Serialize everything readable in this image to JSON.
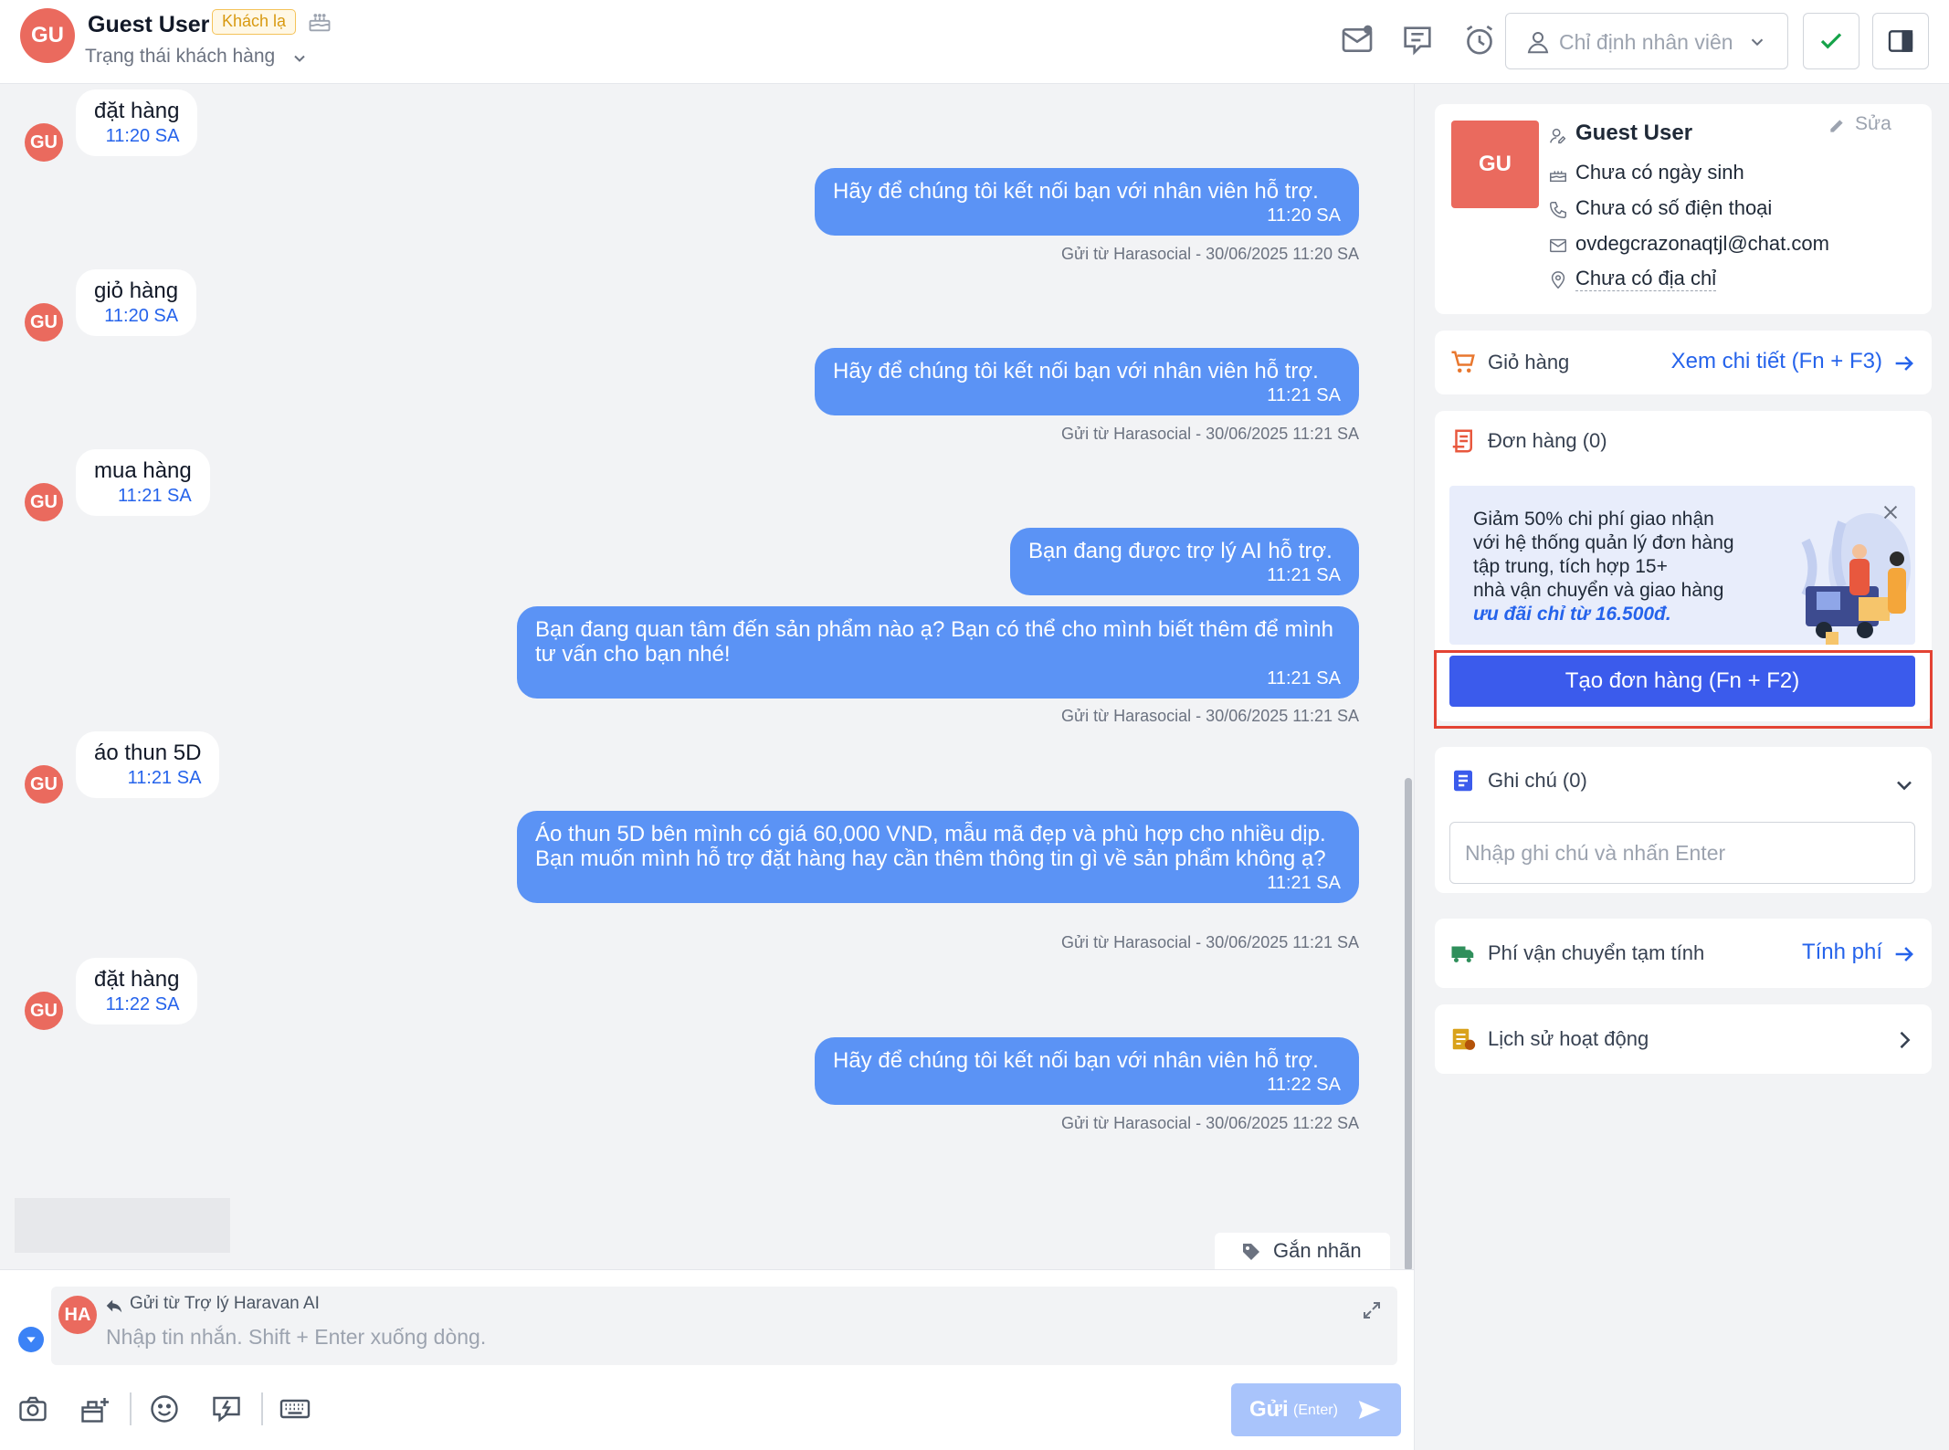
{
  "header": {
    "avatar": "GU",
    "name": "Guest User",
    "badge": "Khách lạ",
    "status": "Trạng thái khách hàng",
    "assign_placeholder": "Chỉ định nhân viên"
  },
  "messages": [
    {
      "dir": "in",
      "text": "đặt hàng",
      "time": "11:20 SA"
    },
    {
      "dir": "out",
      "text": "Hãy để chúng tôi kết nối bạn với nhân viên hỗ trợ.",
      "time": "11:20 SA",
      "meta": "Gửi từ Harasocial - 30/06/2025 11:20 SA"
    },
    {
      "dir": "in",
      "text": "giỏ hàng",
      "time": "11:20 SA"
    },
    {
      "dir": "out",
      "text": "Hãy để chúng tôi kết nối bạn với nhân viên hỗ trợ.",
      "time": "11:21 SA",
      "meta": "Gửi từ Harasocial - 30/06/2025 11:21 SA"
    },
    {
      "dir": "in",
      "text": "mua hàng",
      "time": "11:21 SA"
    },
    {
      "dir": "out",
      "text": "Bạn đang được trợ lý AI hỗ trợ.",
      "time": "11:21 SA"
    },
    {
      "dir": "out",
      "text": "Bạn đang quan tâm đến sản phẩm nào ạ? Bạn có thể cho mình biết thêm để mình tư vấn cho bạn nhé!",
      "time": "11:21 SA",
      "meta": "Gửi từ Harasocial - 30/06/2025 11:21 SA"
    },
    {
      "dir": "in",
      "text": "áo thun 5D",
      "time": "11:21 SA"
    },
    {
      "dir": "out",
      "text": "Áo thun 5D bên mình có giá 60,000 VND, mẫu mã đẹp và phù hợp cho nhiều dịp. Bạn muốn mình hỗ trợ đặt hàng hay cần thêm thông tin gì về sản phẩm không ạ?",
      "time": "11:21 SA",
      "meta": "Gửi từ Harasocial - 30/06/2025 11:21 SA"
    },
    {
      "dir": "in",
      "text": "đặt hàng",
      "time": "11:22 SA"
    },
    {
      "dir": "out",
      "text": "Hãy để chúng tôi kết nối bạn với nhân viên hỗ trợ.",
      "time": "11:22 SA",
      "meta": "Gửi từ Harasocial - 30/06/2025 11:22 SA"
    }
  ],
  "msg_avatar": "GU",
  "tag_label": "Gắn nhãn",
  "composer": {
    "avatar": "HA",
    "from": "Gửi từ Trợ lý Haravan AI",
    "placeholder": "Nhập tin nhắn. Shift + Enter xuống dòng.",
    "send_label": "Gửi",
    "send_hint": "(Enter)"
  },
  "profile": {
    "avatar": "GU",
    "name": "Guest User",
    "edit": "Sửa",
    "birthday": "Chưa có ngày sinh",
    "phone": "Chưa có số điện thoại",
    "email": "ovdegcrazonaqtjl@chat.com",
    "address": "Chưa có địa chỉ"
  },
  "cart": {
    "label": "Giỏ hàng",
    "link": "Xem chi tiết (Fn + F3)"
  },
  "orders": {
    "label": "Đơn hàng (0)",
    "promo_lines": [
      "Giảm 50% chi phí giao nhận",
      "với hệ thống quản lý đơn hàng",
      "tập trung, tích hợp 15+",
      "nhà vận chuyển và giao hàng"
    ],
    "promo_highlight": "ưu đãi chỉ từ 16.500đ.",
    "create_button": "Tạo đơn hàng (Fn + F2)"
  },
  "notes": {
    "label": "Ghi chú (0)",
    "placeholder": "Nhập ghi chú và nhấn Enter"
  },
  "shipping": {
    "label": "Phí vận chuyển tạm tính",
    "link": "Tính phí"
  },
  "history": {
    "label": "Lịch sử hoạt động"
  },
  "colors": {
    "accent": "#3b5bec",
    "bubble_out": "#5b93f5",
    "avatar": "#ea6a5e",
    "highlight": "#e34334"
  }
}
